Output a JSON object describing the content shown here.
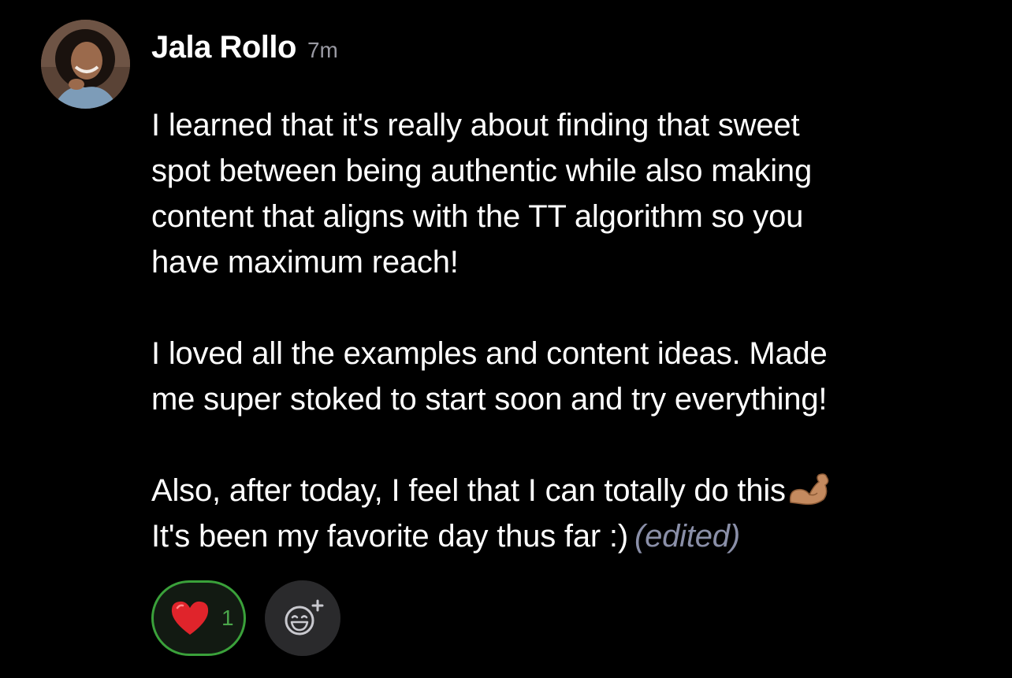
{
  "message": {
    "author": "Jala Rollo",
    "timestamp": "7m",
    "paragraphs": [
      [
        "I learned that it's really about finding that sweet",
        "spot between being authentic while also making",
        "content that aligns with the TT algorithm so you",
        "have maximum reach!"
      ],
      [
        "I loved all the examples and content ideas. Made",
        "me super stoked to start soon and try everything!"
      ],
      [
        "Also, after today, I feel that I can totally do this",
        "It's been my favorite day thus far :)"
      ]
    ],
    "inline_emoji": "flexed-biceps-icon",
    "edited_label": "(edited)"
  },
  "reactions": [
    {
      "emoji": "heart-icon",
      "count": "1",
      "selected": true
    }
  ],
  "add_reaction_icon": "add-reaction-icon",
  "colors": {
    "background": "#000000",
    "author": "#ffffff",
    "timestamp": "#9a9aa3",
    "edited": "#8a8fa8",
    "reaction_border": "#3aa13a",
    "reaction_count": "#4aa64a",
    "heart": "#e0242b"
  }
}
